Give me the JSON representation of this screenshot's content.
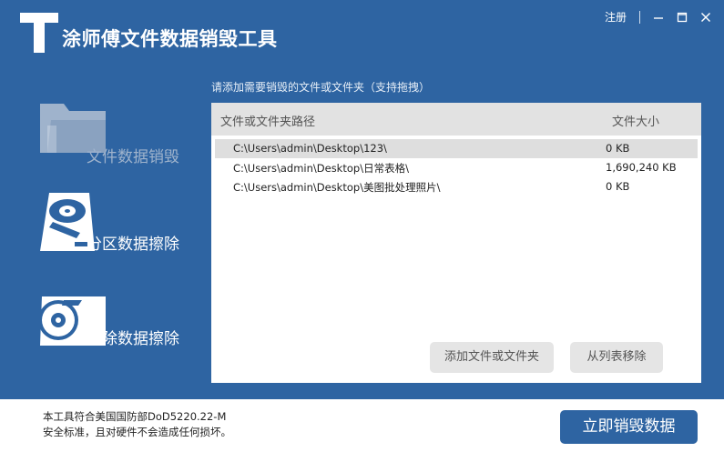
{
  "app": {
    "title": "涂师傅文件数据销毁工具"
  },
  "window_controls": {
    "register_label": "注册"
  },
  "sidebar": {
    "items": [
      {
        "label": "文件数据销毁",
        "icon": "folder-icon",
        "active": true
      },
      {
        "label": "分区数据擦除",
        "icon": "hard-disk-icon",
        "active": false
      },
      {
        "label": "删除数据擦除",
        "icon": "disk-delete-icon",
        "active": false
      }
    ]
  },
  "main": {
    "hint": "请添加需要销毁的文件或文件夹（支持拖拽）",
    "columns": {
      "path": "文件或文件夹路径",
      "size": "文件大小"
    },
    "rows": [
      {
        "path": "C:\\Users\\admin\\Desktop\\123\\",
        "size": "0 KB",
        "selected": true
      },
      {
        "path": "C:\\Users\\admin\\Desktop\\日常表格\\",
        "size": "1,690,240 KB",
        "selected": false
      },
      {
        "path": "C:\\Users\\admin\\Desktop\\美图批处理照片\\",
        "size": "0 KB",
        "selected": false
      }
    ],
    "add_button": "添加文件或文件夹",
    "remove_button": "从列表移除"
  },
  "footer": {
    "notice_line1": "本工具符合美国国防部DoD5220.22-M",
    "notice_line2": "安全标准，且对硬件不会造成任何损坏。",
    "destroy_button": "立即销毁数据"
  },
  "colors": {
    "primary": "#2e64a2",
    "panel": "#ffffff",
    "header_gray": "#e2e2e2",
    "button_gray": "#e5e5e5"
  }
}
